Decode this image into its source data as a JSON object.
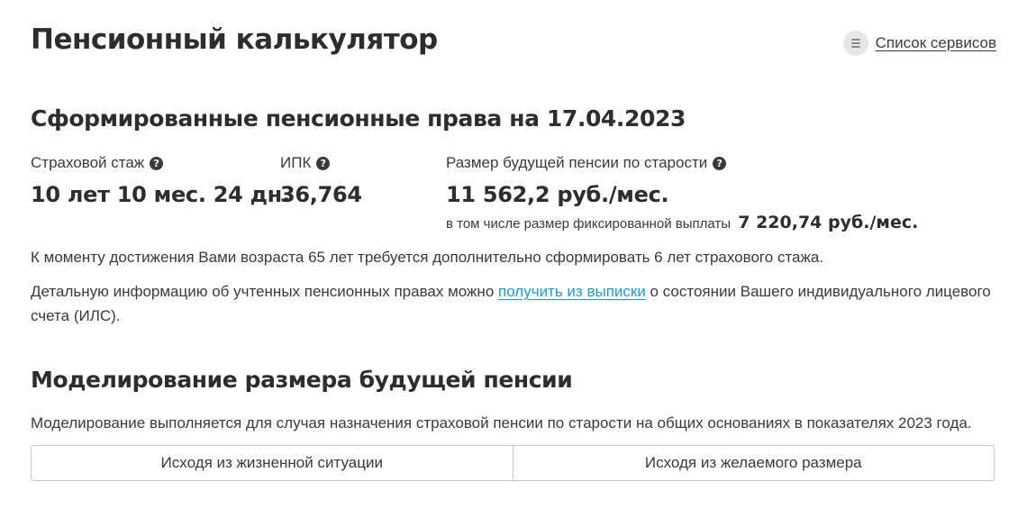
{
  "header": {
    "title": "Пенсионный калькулятор",
    "services_link": "Список сервисов",
    "services_icon": "list-icon"
  },
  "rights": {
    "title": "Сформированные пенсионные права на 17.04.2023",
    "stats": [
      {
        "label": "Страховой стаж",
        "value": "10 лет 10 мес. 24 дн."
      },
      {
        "label": "ИПК",
        "value": "36,764"
      },
      {
        "label": "Размер будущей пенсии по старости",
        "value": "11 562,2 руб./мес.",
        "sub_label": "в том числе размер фиксированной выплаты",
        "sub_value": "7 220,74 руб./мес."
      }
    ],
    "help_icon": "question-circle-icon",
    "notice": "К моменту достижения Вами возраста 65 лет требуется дополнительно сформировать 6 лет страхового стажа.",
    "detail_before": "Детальную информацию об учтенных пенсионных правах можно ",
    "detail_link": "получить из выписки",
    "detail_after": " о состоянии Вашего индивидуального лицевого счета (ИЛС)."
  },
  "modeling": {
    "title": "Моделирование размера будущей пенсии",
    "description": "Моделирование выполняется для случая назначения страховой пенсии по старости на общих основаниях в показателях 2023 года.",
    "tabs": [
      {
        "label": "Исходя из жизненной ситуации"
      },
      {
        "label": "Исходя из желаемого размера"
      }
    ]
  },
  "colors": {
    "link": "#1d9bd1",
    "text": "#3a3a3a",
    "heading": "#2d2d2d",
    "border": "#c8c8c8"
  }
}
